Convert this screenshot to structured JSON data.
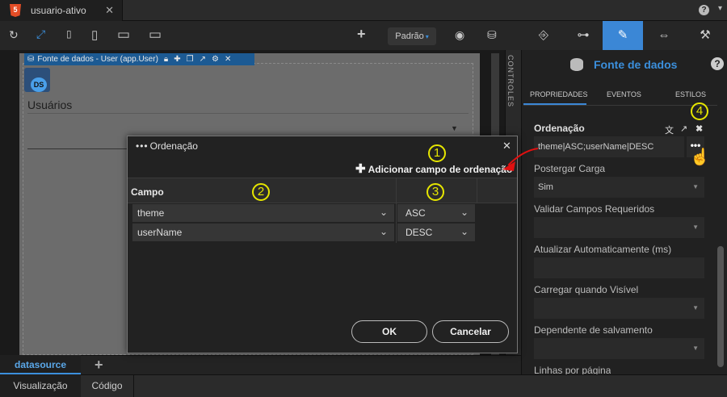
{
  "file_tab": {
    "label": "usuario-ativo",
    "close": "✕",
    "html5": "5"
  },
  "top_help": "?",
  "toolbar": {
    "refresh": "↻",
    "expand": "⤢",
    "phone": "▯",
    "tablet": "▯",
    "desktop": "▭",
    "monitor": "▭",
    "add": "+",
    "padrao": "Padrão",
    "eye": "◉",
    "db": "⛁"
  },
  "canvas": {
    "ds_header": "Fonte de dados - User (app.User)",
    "ds_badge": "DS",
    "usuarios_label": "Usuários",
    "controls_label": "CONTROLES"
  },
  "bottom": {
    "ds_tab": "datasource",
    "add_tab": "+",
    "view_tab": "Visualização",
    "code_tab": "Código"
  },
  "right_panel": {
    "tabs": [
      "⎆",
      "⊶",
      "✎",
      "⇔",
      "⚒"
    ],
    "title": "Fonte de dados",
    "help": "?",
    "subtabs": [
      "PROPRIEDADES",
      "EVENTOS",
      "ESTILOS"
    ],
    "ordenacao_label": "Ordenação",
    "ordenacao_value": "theme|ASC;userName|DESC",
    "ordenacao_more": "•••",
    "postergar_label": "Postergar Carga",
    "postergar_value": "Sim",
    "validar_label": "Validar Campos Requeridos",
    "atualizar_label": "Atualizar Automaticamente (ms)",
    "carregar_label": "Carregar quando Visível",
    "dependente_label": "Dependente de salvamento",
    "linhas_label": "Linhas por página"
  },
  "annotations": [
    "1",
    "2",
    "3",
    "4"
  ],
  "modal": {
    "title": "Ordenação",
    "add_field": "Adicionar campo de ordenação",
    "header_campo": "Campo",
    "rows": [
      {
        "field": "theme",
        "direction": "ASC"
      },
      {
        "field": "userName",
        "direction": "DESC"
      }
    ],
    "ok": "OK",
    "cancel": "Cancelar",
    "close": "✕"
  },
  "colors": {
    "accent": "#3b87d6",
    "annotation": "#e6e600",
    "arrow": "#e01010"
  }
}
